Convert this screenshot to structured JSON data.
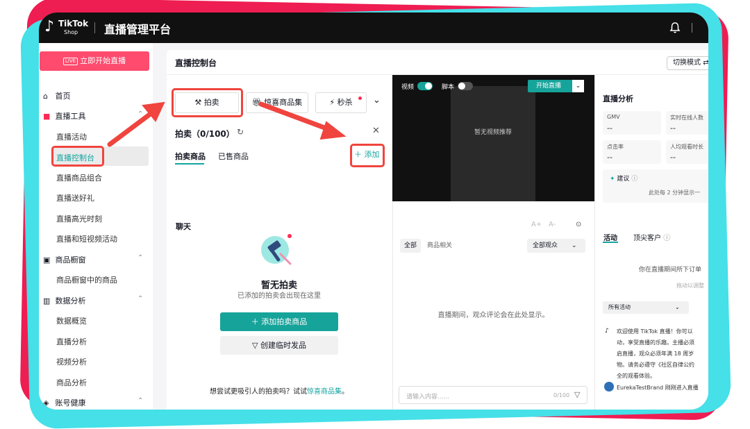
{
  "header": {
    "brand": "TikTok",
    "brand_sub": "Shop",
    "title": "直播管理平台"
  },
  "sidebar": {
    "live_button": "立即开始直播",
    "live_icon_text": "LIVE",
    "groups": [
      {
        "label": "首页"
      },
      {
        "label": "直播工具",
        "items": [
          "直播活动",
          "直播控制台",
          "直播商品组合",
          "直播送好礼",
          "直播高光时刻",
          "直播和短视频活动"
        ]
      },
      {
        "label": "商品橱窗",
        "items": [
          "商品橱窗中的商品"
        ]
      },
      {
        "label": "数据分析",
        "items": [
          "数据概览",
          "直播分析",
          "视频分析",
          "商品分析"
        ]
      },
      {
        "label": "账号健康"
      }
    ]
  },
  "main": {
    "title": "直播控制台",
    "switch_mode": "切换模式"
  },
  "tools": {
    "buttons": [
      "拍卖",
      "惊喜商品集",
      "秒杀"
    ],
    "panel_title": "拍卖（0/100）",
    "tabs": [
      "拍卖商品",
      "已售商品"
    ],
    "add": "添加",
    "empty_title": "暂无拍卖",
    "empty_desc": "已添加的拍卖会出现在这里",
    "add_auction_btn": "添加拍卖商品",
    "create_temp_btn": "创建临时发品",
    "try_text": "想尝试更吸引人的拍卖吗？试试",
    "try_link": "惊喜商品集",
    "try_suffix": "。"
  },
  "video": {
    "video_toggle": "视频",
    "script_toggle": "脚本",
    "start_live": "开始直播",
    "no_video": "暂无视频推荐"
  },
  "chat": {
    "title": "聊天",
    "font_up": "A+",
    "font_down": "A-",
    "filters": [
      "全部",
      "商品相关"
    ],
    "audience_select": "全部观众",
    "empty": "直播期间，观众评论会在此处显示。",
    "input_placeholder": "请输入内容......",
    "input_count": "0/100"
  },
  "analytics": {
    "title": "直播分析",
    "metrics": [
      {
        "label": "GMV",
        "value": "--"
      },
      {
        "label": "实时在线人数",
        "value": "--"
      },
      {
        "label": "点击率",
        "value": "--"
      },
      {
        "label": "人均观看时长",
        "value": "--"
      }
    ],
    "suggest_label": "建议",
    "suggest_note": "此处每 2 分钟显示一",
    "tabs": [
      "活动",
      "顶尖客户"
    ],
    "activity_empty": "你在直播期间所下订单",
    "activity_drag": "拖动以调整",
    "activity_filter": "所有活动",
    "welcome_lines": [
      "欢迎使用 TikTok 直播！你可以",
      "动，享受直播的乐趣。主播必须",
      "启直播，观众必须年满 18 周岁",
      "物。请务必遵守《社区自律公约",
      "全的观看体验。"
    ],
    "entered": "EurekaTestBrand 刚刚进入直播"
  }
}
